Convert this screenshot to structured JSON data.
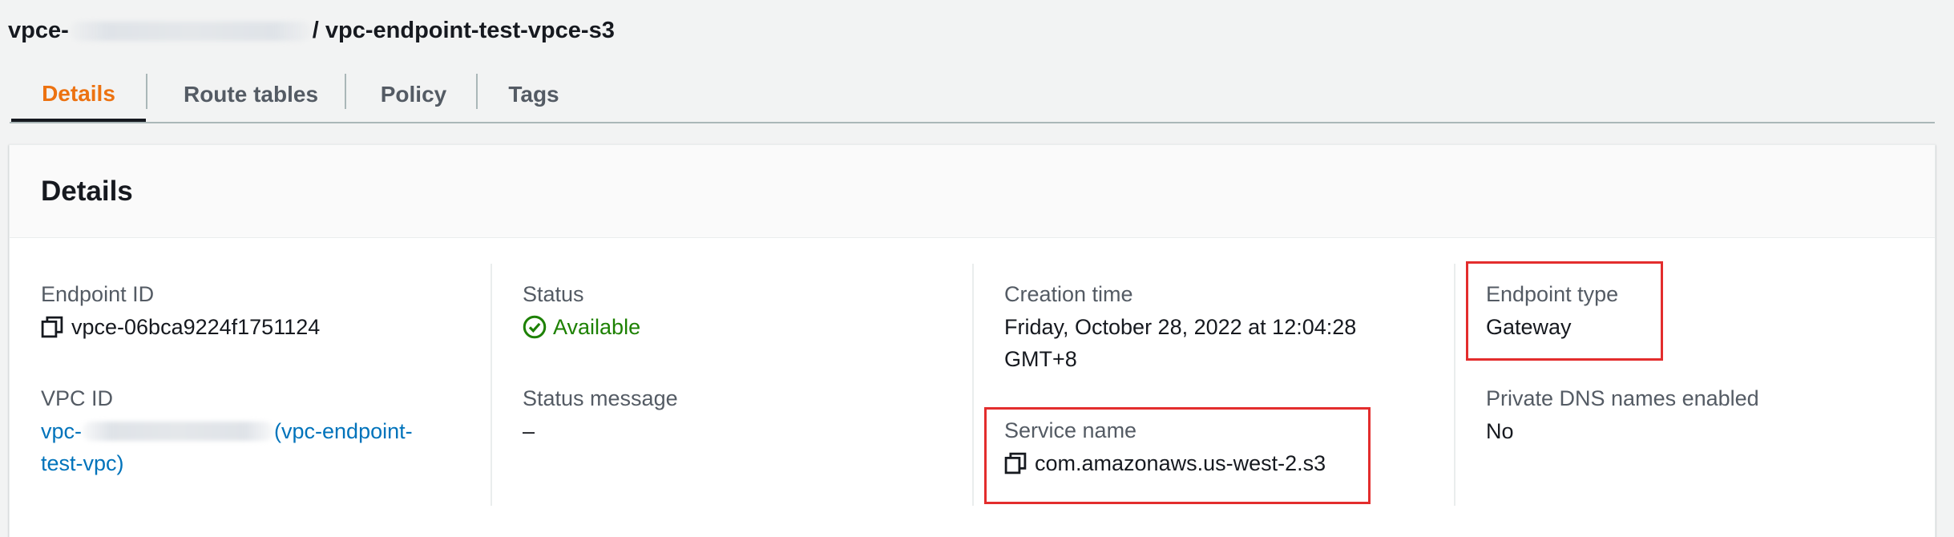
{
  "header": {
    "prefix": "vpce-",
    "suffix": "/ vpc-endpoint-test-vpce-s3"
  },
  "tabs": [
    {
      "label": "Details",
      "active": true
    },
    {
      "label": "Route tables",
      "active": false
    },
    {
      "label": "Policy",
      "active": false
    },
    {
      "label": "Tags",
      "active": false
    }
  ],
  "details": {
    "title": "Details",
    "endpoint_id": {
      "label": "Endpoint ID",
      "value": "vpce-06bca9224f1751124",
      "icon": "copy-icon"
    },
    "vpc_id": {
      "label": "VPC ID",
      "prefix": "vpc-",
      "suffix": "(vpc-endpoint-",
      "line2": "test-vpc)"
    },
    "status": {
      "label": "Status",
      "value": "Available",
      "icon": "check-circle-icon",
      "color": "#1d8102"
    },
    "status_message": {
      "label": "Status message",
      "value": "–"
    },
    "creation_time": {
      "label": "Creation time",
      "line1": "Friday, October 28, 2022 at 12:04:28",
      "line2": "GMT+8"
    },
    "service_name": {
      "label": "Service name",
      "value": "com.amazonaws.us-west-2.s3",
      "icon": "copy-icon"
    },
    "endpoint_type": {
      "label": "Endpoint type",
      "value": "Gateway"
    },
    "private_dns": {
      "label": "Private DNS names enabled",
      "value": "No"
    }
  },
  "colors": {
    "active_tab": "#ec7211",
    "link": "#0073bb",
    "highlight": "#e32d2d"
  }
}
